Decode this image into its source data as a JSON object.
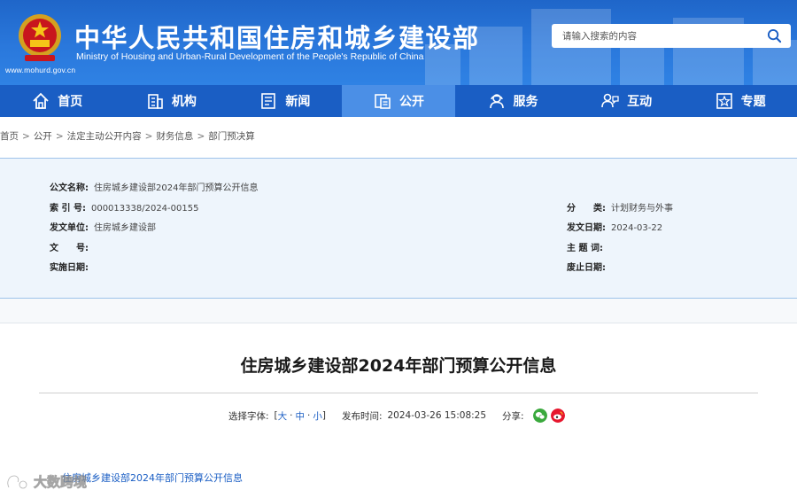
{
  "header": {
    "site_url": "www.mohurd.gov.cn",
    "title": "中华人民共和国住房和城乡建设部",
    "subtitle": "Ministry of Housing and Urban-Rural Development of the People's Republic of China",
    "emblem_icon": "national-emblem-icon",
    "search": {
      "placeholder": "请输入搜索的内容",
      "icon": "search-icon"
    },
    "colors": {
      "banner": "#2a78dc",
      "nav": "#1a5ec4",
      "nav_active": "#4b8fe6"
    }
  },
  "nav": {
    "items": [
      {
        "label": "首页",
        "icon": "home-icon"
      },
      {
        "label": "机构",
        "icon": "building-icon"
      },
      {
        "label": "新闻",
        "icon": "news-icon"
      },
      {
        "label": "公开",
        "icon": "disclosure-icon"
      },
      {
        "label": "服务",
        "icon": "service-icon"
      },
      {
        "label": "互动",
        "icon": "interaction-icon"
      },
      {
        "label": "专题",
        "icon": "topic-icon"
      }
    ],
    "active_index": 3
  },
  "breadcrumb": [
    "首页",
    "公开",
    "法定主动公开内容",
    "财务信息",
    "部门预决算"
  ],
  "info": {
    "doc_name_label": "公文名称:",
    "doc_name": "住房城乡建设部2024年部门预算公开信息",
    "index_label": "索 引 号:",
    "index": "000013338/2024-00155",
    "category_label": "分　　类:",
    "category": "计划财务与外事",
    "issuer_label": "发文单位:",
    "issuer": "住房城乡建设部",
    "issue_date_label": "发文日期:",
    "issue_date": "2024-03-22",
    "doc_no_label": "文　　号:",
    "doc_no": "",
    "keywords_label": "主 题 词:",
    "keywords": "",
    "effective_label": "实施日期:",
    "effective": "",
    "expiry_label": "废止日期:",
    "expiry": ""
  },
  "article": {
    "title": "住房城乡建设部2024年部门预算公开信息",
    "font_size_label": "选择字体:",
    "font_size_open": "[",
    "font_large": "大",
    "font_medium": "中",
    "font_small": "小",
    "font_dot1": "·",
    "font_dot2": "·",
    "font_size_close": "]",
    "publish_label": "发布时间:",
    "publish_time": "2024-03-26 15:08:25",
    "share_label": "分享:",
    "share_icons": [
      "wechat-icon",
      "weibo-icon"
    ],
    "body_link": "住房城乡建设部2024年部门预算公开信息"
  },
  "watermark": {
    "text": "大数跨境",
    "icon": "watermark-logo-icon"
  }
}
